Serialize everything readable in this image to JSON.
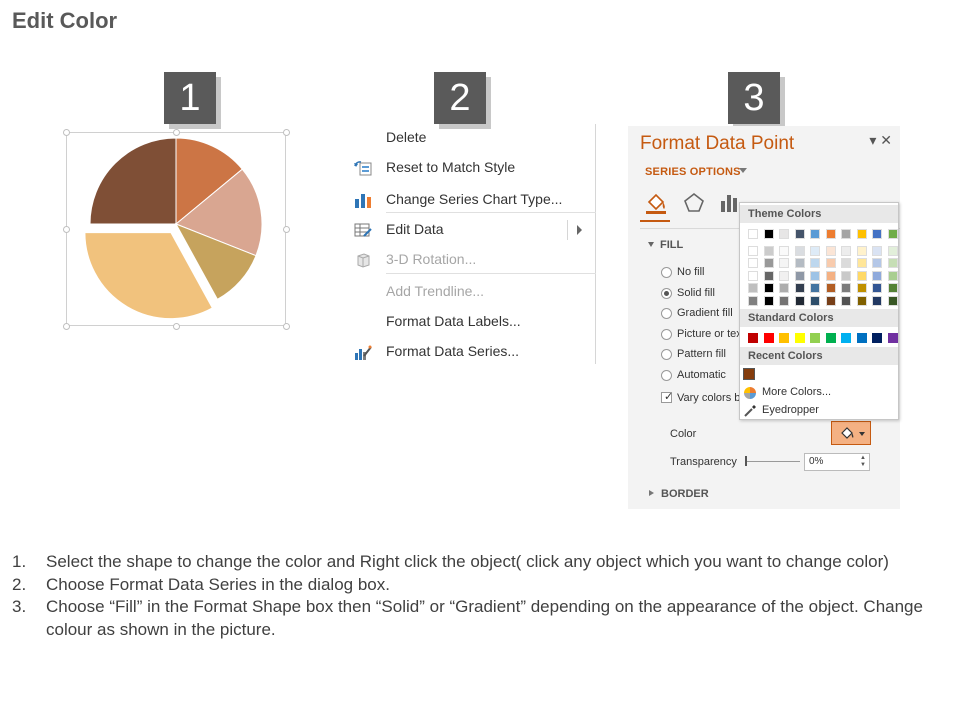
{
  "page": {
    "title": "Edit Color"
  },
  "steps": {
    "one": "1",
    "two": "2",
    "three": "3"
  },
  "pie": {
    "slices": [
      {
        "color": "#7f4f36",
        "value": 25
      },
      {
        "color": "#cc7545",
        "value": 14
      },
      {
        "color": "#d9a691",
        "value": 17
      },
      {
        "color": "#c6a35d",
        "value": 11
      },
      {
        "color": "#f1c27d",
        "value": 33
      }
    ]
  },
  "context_menu": {
    "items": [
      {
        "label": "Delete",
        "icon": "",
        "disabled": false
      },
      {
        "label": "Reset to Match Style",
        "icon": "reset-style-icon",
        "disabled": false
      },
      {
        "label": "Change Series Chart Type...",
        "icon": "bar-chart-icon",
        "disabled": false
      },
      {
        "label": "Edit Data",
        "icon": "edit-data-icon",
        "disabled": false
      },
      {
        "label": "3-D Rotation...",
        "icon": "cube-icon",
        "disabled": true
      },
      {
        "label": "Add Trendline...",
        "icon": "",
        "disabled": true
      },
      {
        "label": "Format Data Labels...",
        "icon": "",
        "disabled": false
      },
      {
        "label": "Format Data Series...",
        "icon": "format-series-icon",
        "disabled": false
      }
    ]
  },
  "format_panel": {
    "title": "Format Data Point",
    "controls": "▾ ✕",
    "series_options": "SERIES OPTIONS",
    "fill_header": "FILL",
    "fill_options": [
      "No fill",
      "Solid fill",
      "Gradient fill",
      "Picture or tex",
      "Pattern fill",
      "Automatic"
    ],
    "selected_fill": "Solid fill",
    "vary_colors": "Vary colors b",
    "color_label": "Color",
    "transparency_label": "Transparency",
    "transparency_value": "0%",
    "border_header": "BORDER",
    "accent": "#c55a11"
  },
  "color_dropdown": {
    "theme_header": "Theme Colors",
    "standard_header": "Standard Colors",
    "recent_header": "Recent Colors",
    "more_colors": "More Colors...",
    "eyedropper": "Eyedropper",
    "theme_top": [
      "#ffffff",
      "#000000",
      "#e7e6e6",
      "#44546a",
      "#5b9bd5",
      "#ed7d31",
      "#a5a5a5",
      "#ffc000",
      "#4472c4",
      "#70ad47"
    ],
    "standard": [
      "#c00000",
      "#ff0000",
      "#ffc000",
      "#ffff00",
      "#92d050",
      "#00b050",
      "#00b0f0",
      "#0070c0",
      "#002060",
      "#7030a0"
    ],
    "recent": [
      "#843c0c"
    ]
  },
  "instructions": [
    {
      "num": "1.",
      "text": "Select the shape to change the color and Right click the object( click any object which you want to change color)"
    },
    {
      "num": "2.",
      "text": "Choose Format Data Series in the dialog box."
    },
    {
      "num": "3.",
      "text": "Choose “Fill” in the Format Shape box then “Solid” or “Gradient” depending on the appearance of the object. Change colour as shown in the picture."
    }
  ]
}
